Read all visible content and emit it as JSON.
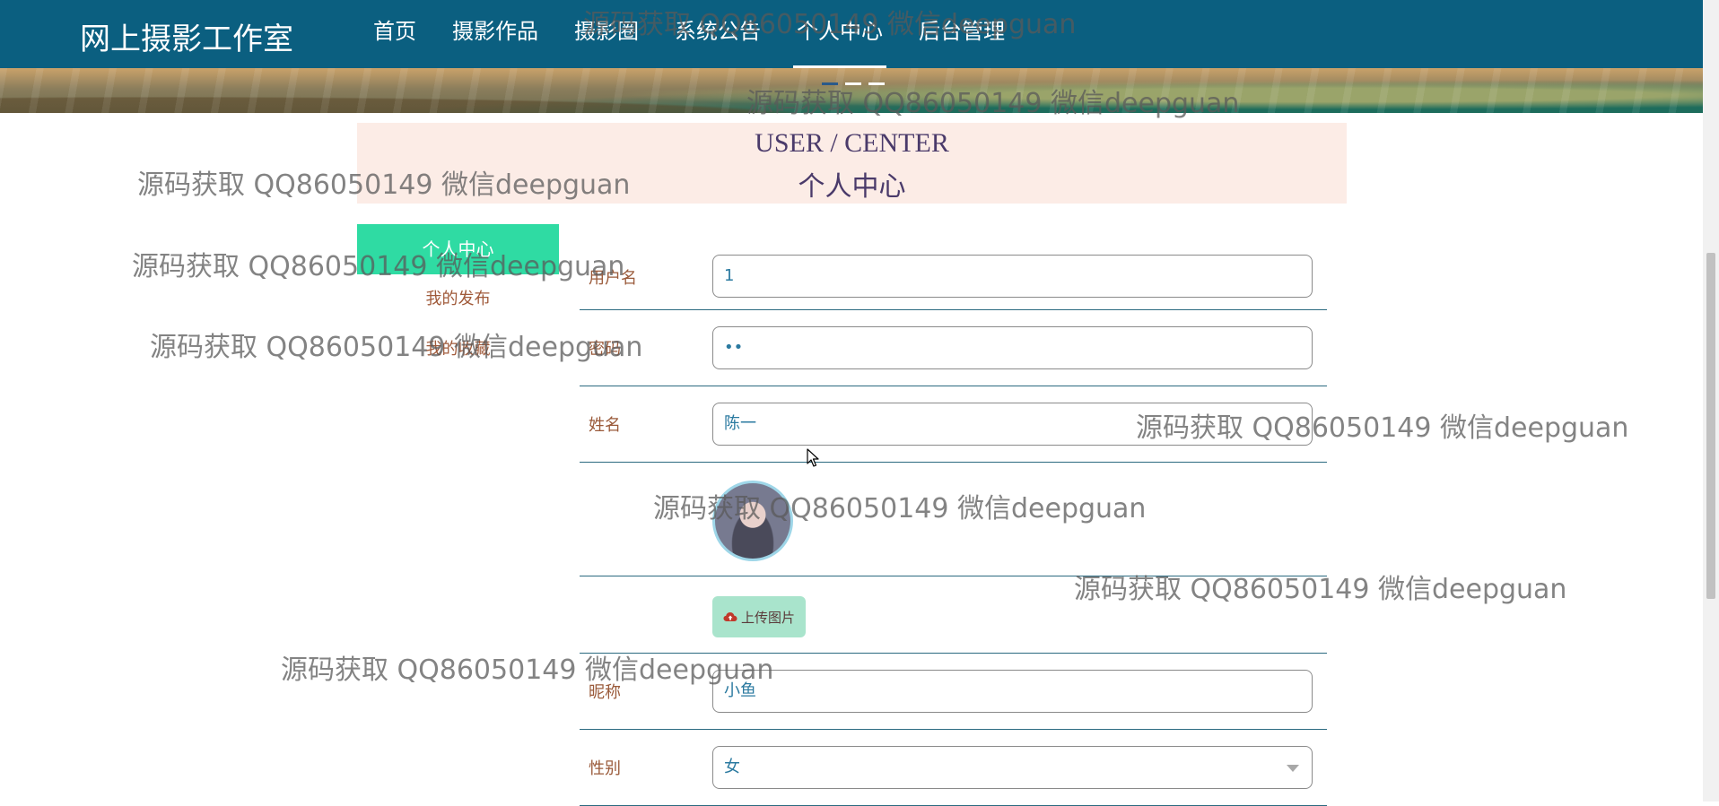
{
  "app": {
    "brand": "网上摄影工作室"
  },
  "nav": {
    "items": [
      {
        "label": "首页",
        "active": false
      },
      {
        "label": "摄影作品",
        "active": false
      },
      {
        "label": "摄影圈",
        "active": false
      },
      {
        "label": "系统公告",
        "active": false
      },
      {
        "label": "个人中心",
        "active": true
      },
      {
        "label": "后台管理",
        "active": false
      }
    ]
  },
  "banner": {
    "slides": 3,
    "active_slide": 0
  },
  "header": {
    "title_en": "USER / CENTER",
    "title_cn": "个人中心"
  },
  "side_menu": {
    "items": [
      {
        "label": "个人中心",
        "active": true
      },
      {
        "label": "我的发布",
        "active": false
      },
      {
        "label": "我的收藏",
        "active": false
      }
    ]
  },
  "form": {
    "username": {
      "label": "用户名",
      "value": "1"
    },
    "password": {
      "label": "密码",
      "value": "••"
    },
    "name": {
      "label": "姓名",
      "value": "陈一"
    },
    "avatar": {
      "icon": "user-avatar-image"
    },
    "upload": {
      "label": "上传图片",
      "icon": "cloud-upload-icon"
    },
    "nickname": {
      "label": "昵称",
      "value": "小鱼"
    },
    "gender": {
      "label": "性别",
      "value": "女"
    }
  },
  "watermark": {
    "text": "源码获取 QQ86050149 微信deepguan"
  },
  "colors": {
    "topbar": "#0b5f80",
    "side_active": "#2fdba3",
    "title_bg": "#fcece6",
    "label": "#9a5a3a",
    "value": "#2b7aa0",
    "upload_btn": "#a9e4cc"
  }
}
